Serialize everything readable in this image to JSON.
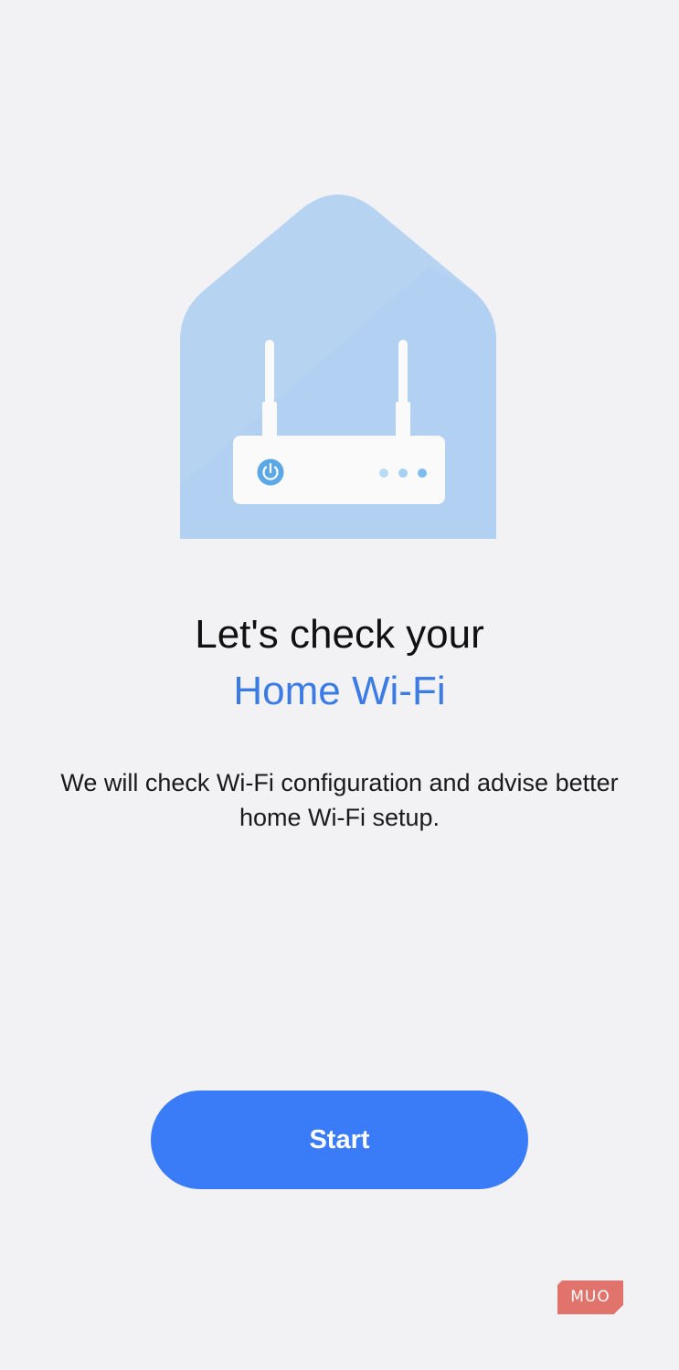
{
  "hero": {
    "illustration": "home-router-icon",
    "colors": {
      "house": "#b7d3f2",
      "router": "#fafafa",
      "power_icon": "#5aa8e6",
      "status_dots": "#9ac8ef"
    }
  },
  "title": {
    "line1": "Let's check your",
    "line2": "Home Wi-Fi",
    "accent_color": "#3a7be5"
  },
  "description": "We will check Wi-Fi configuration and advise better home Wi-Fi setup.",
  "actions": {
    "start_label": "Start",
    "start_color": "#3a7bf8"
  },
  "watermark": {
    "text": "MUO",
    "color": "#e0736b"
  }
}
